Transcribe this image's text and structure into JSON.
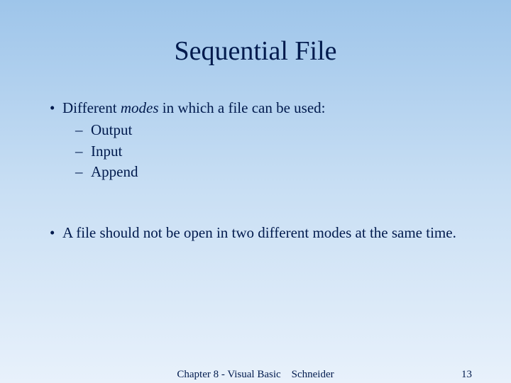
{
  "title": "Sequential File",
  "bullet1_prefix": "Different ",
  "bullet1_italic": "modes",
  "bullet1_suffix": " in which a file can be used:",
  "sub1": "Output",
  "sub2": "Input",
  "sub3": "Append",
  "bullet2": "A file should not be open in two different modes at the same time.",
  "footer_center": "Chapter 8 - Visual Basic Schneider",
  "footer_page": "13"
}
